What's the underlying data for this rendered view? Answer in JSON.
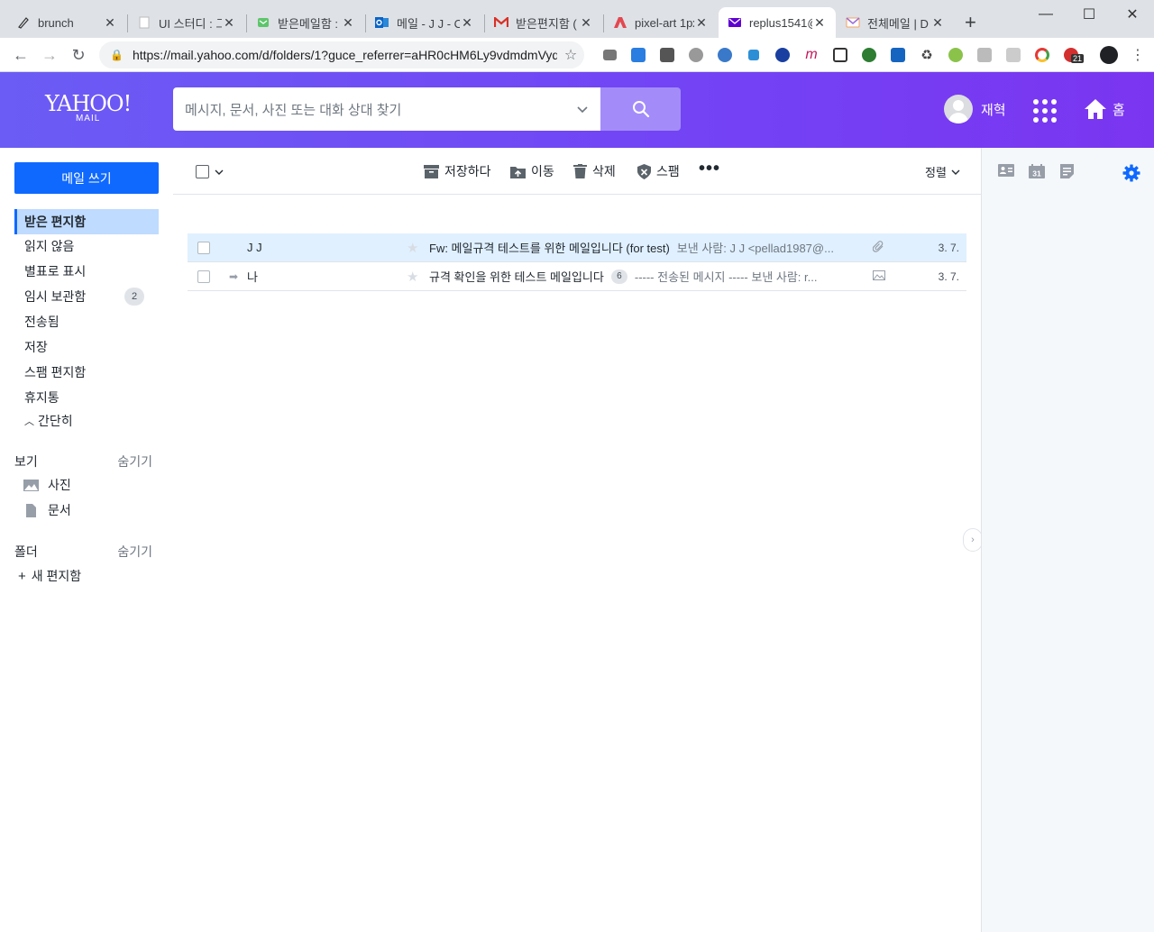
{
  "browser": {
    "tabs": [
      {
        "title": "brunch",
        "icon": "brunch-pen-icon"
      },
      {
        "title": "UI 스터디 : 그",
        "icon": "blank-page-icon"
      },
      {
        "title": "받은메일함 :",
        "icon": "mail-green-icon"
      },
      {
        "title": "메일 - J J - O",
        "icon": "outlook-icon"
      },
      {
        "title": "받은편지함 (",
        "icon": "gmail-icon"
      },
      {
        "title": "pixel-art 1px",
        "icon": "adobe-icon"
      },
      {
        "title": "replus1541@",
        "icon": "yahoo-mail-icon",
        "active": true
      },
      {
        "title": "전체메일 | D",
        "icon": "daum-mail-icon"
      }
    ],
    "url": "https://mail.yahoo.com/d/folders/1?guce_referrer=aHR0cHM6Ly9vdmdmVyd...",
    "extension_badge": "21"
  },
  "header": {
    "logo_main": "YAHOO!",
    "logo_sub": "MAIL",
    "search_placeholder": "메시지, 문서, 사진 또는 대화 상대 찾기",
    "user_name": "재혁",
    "home_label": "홈"
  },
  "sidebar": {
    "compose_label": "메일 쓰기",
    "folders": [
      {
        "label": "받은 편지함",
        "selected": true
      },
      {
        "label": "읽지 않음"
      },
      {
        "label": "별표로 표시"
      },
      {
        "label": "임시 보관함",
        "count": "2"
      },
      {
        "label": "전송됨"
      },
      {
        "label": "저장"
      },
      {
        "label": "스팸 편지함"
      },
      {
        "label": "휴지통"
      }
    ],
    "collapse_label": "간단히",
    "views_title": "보기",
    "views_hide": "숨기기",
    "views": [
      "사진",
      "문서"
    ],
    "folders_title": "폴더",
    "folders_hide": "숨기기",
    "new_folder": "새 편지함"
  },
  "toolbar": {
    "archive": "저장하다",
    "move": "이동",
    "delete": "삭제",
    "spam": "스팸",
    "sort": "정렬"
  },
  "messages": [
    {
      "from": "J J",
      "subject": "Fw: 메일규격 테스트를 위한 메일입니다 (for test)",
      "preview": "보낸 사람: J J <pellad1987@...",
      "date": "3. 7.",
      "attachment": "paperclip-icon",
      "selected": true
    },
    {
      "from": "나",
      "subject": "규격 확인을 위한 테스트 메일입니다",
      "thread_count": "6",
      "preview": "----- 전송된 메시지 ----- 보낸 사람: r...",
      "date": "3. 7.",
      "attachment": "image-icon",
      "forwarded": true
    }
  ],
  "rightrail": {
    "calendar_day": "31"
  },
  "colors": {
    "header_start": "#6b5cf5",
    "header_end": "#7a35f0",
    "compose": "#0f69ff",
    "selected_folder": "#bfdbff"
  }
}
